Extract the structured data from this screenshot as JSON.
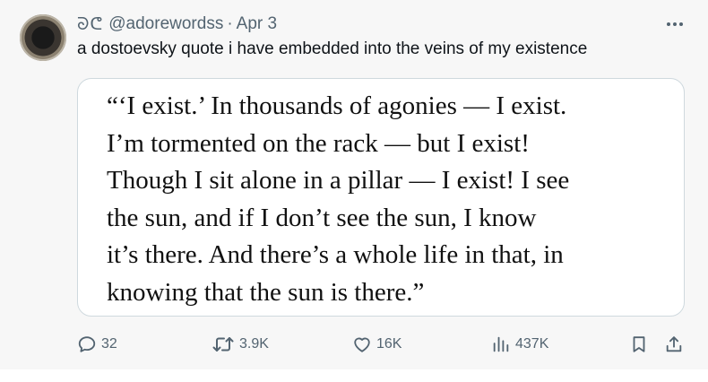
{
  "post": {
    "handle_glyphs": "ᘐᕦ",
    "handle": "@adorewordss",
    "separator": "·",
    "date": "Apr 3",
    "text": "a dostoevsky quote i have embedded into the veins of my existence",
    "quote_lines": [
      "“‘I exist.’ In thousands of agonies — I exist.",
      "I’m tormented on the rack — but I exist!",
      "Though I sit alone in a pillar — I exist! I see",
      "the sun, and if I don’t see the sun, I know",
      "it’s there. And there’s a whole life in that, in",
      "knowing that the sun is there.”"
    ]
  },
  "actions": {
    "replies": "32",
    "reposts": "3.9K",
    "likes": "16K",
    "views": "437K"
  },
  "icons": {
    "more": "more-dots-icon",
    "reply": "reply-bubble-icon",
    "repost": "repost-arrows-icon",
    "like": "heart-icon",
    "views": "views-bar-chart-icon",
    "bookmark": "bookmark-icon",
    "share": "share-upload-icon"
  },
  "colors": {
    "muted_text": "#536471",
    "card_border": "#cfd9de",
    "background": "#f7f7f7"
  }
}
